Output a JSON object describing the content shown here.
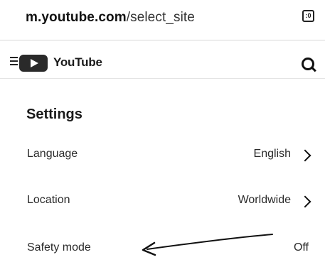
{
  "browser": {
    "url_domain": "m.youtube.com",
    "url_path": "/select_site",
    "tab_count": ":0"
  },
  "header": {
    "title": "YouTube"
  },
  "settings": {
    "title": "Settings",
    "rows": [
      {
        "label": "Language",
        "value": "English"
      },
      {
        "label": "Location",
        "value": "Worldwide"
      },
      {
        "label": "Safety mode",
        "value": "Off"
      }
    ]
  },
  "icons": {
    "menu": "hamburger-menu-icon",
    "logo": "youtube-play-logo",
    "search": "search-icon",
    "tabs": "tab-switcher-icon",
    "chevron": "chevron-right-icon",
    "annotation": "hand-drawn-arrow"
  },
  "colors": {
    "background": "#ffffff",
    "text": "#1a1a1a",
    "divider": "#d8d8d8"
  }
}
